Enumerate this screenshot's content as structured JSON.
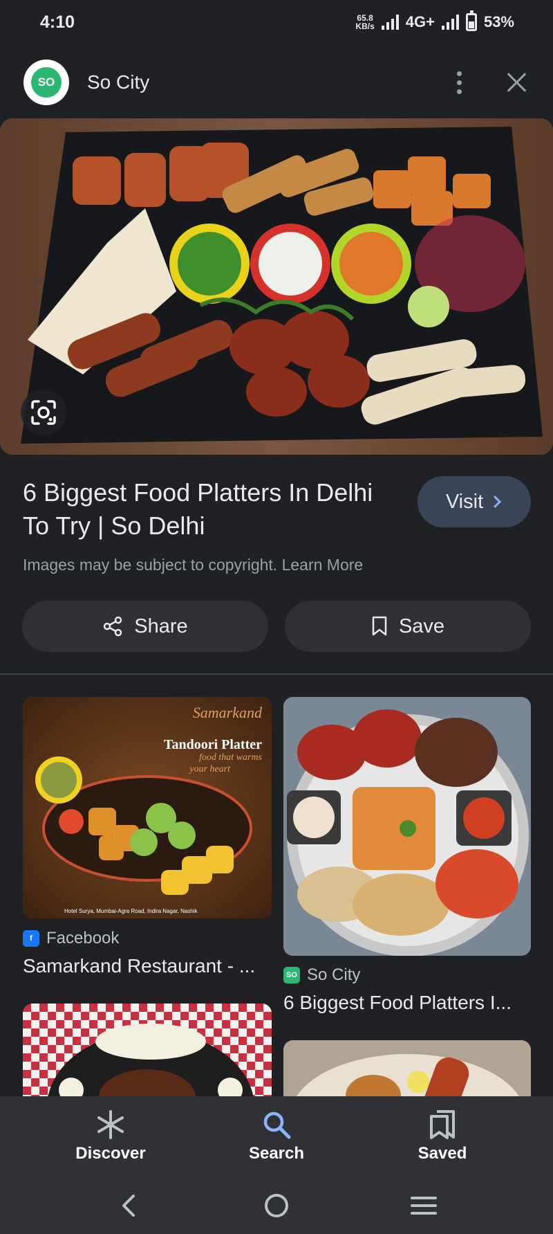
{
  "status_bar": {
    "time": "4:10",
    "speed_value": "65.8",
    "speed_unit": "KB/s",
    "network": "4G+",
    "battery": "53%",
    "battery_level": 0.53
  },
  "header": {
    "logo_text": "SO",
    "title": "So City",
    "menu_icon": "more-vert-icon",
    "close_icon": "close-icon"
  },
  "hero": {
    "lens_icon": "lens-icon"
  },
  "result": {
    "title": "6 Biggest Food Platters In Delhi To Try | So Delhi",
    "visit_label": "Visit",
    "copyright_text": "Images may be subject to copyright. Learn More",
    "share_label": "Share",
    "save_label": "Save"
  },
  "related": [
    {
      "source": "Facebook",
      "caption": "Samarkand Restaurant - ...",
      "overlay_brand": "Samarkand",
      "overlay_title": "Tandoori Platter",
      "overlay_tagline_1": "food that warms",
      "overlay_tagline_2": "your heart",
      "overlay_address": "Hotel Surya, Mumbai-Agra Road, Indira Nagar, Nashik"
    },
    {
      "source": "So City",
      "source_logo": "SO",
      "caption": "6 Biggest Food Platters I..."
    }
  ],
  "bottom_nav": {
    "items": [
      {
        "label": "Discover",
        "icon": "asterisk-icon"
      },
      {
        "label": "Search",
        "icon": "search-icon",
        "active": true
      },
      {
        "label": "Saved",
        "icon": "bookmarks-icon"
      }
    ]
  },
  "colors": {
    "background": "#202124",
    "accent_blue": "#8ab4f8",
    "visit_button": "#394457",
    "so_city_green": "#2cb673",
    "facebook_blue": "#1877f2"
  }
}
